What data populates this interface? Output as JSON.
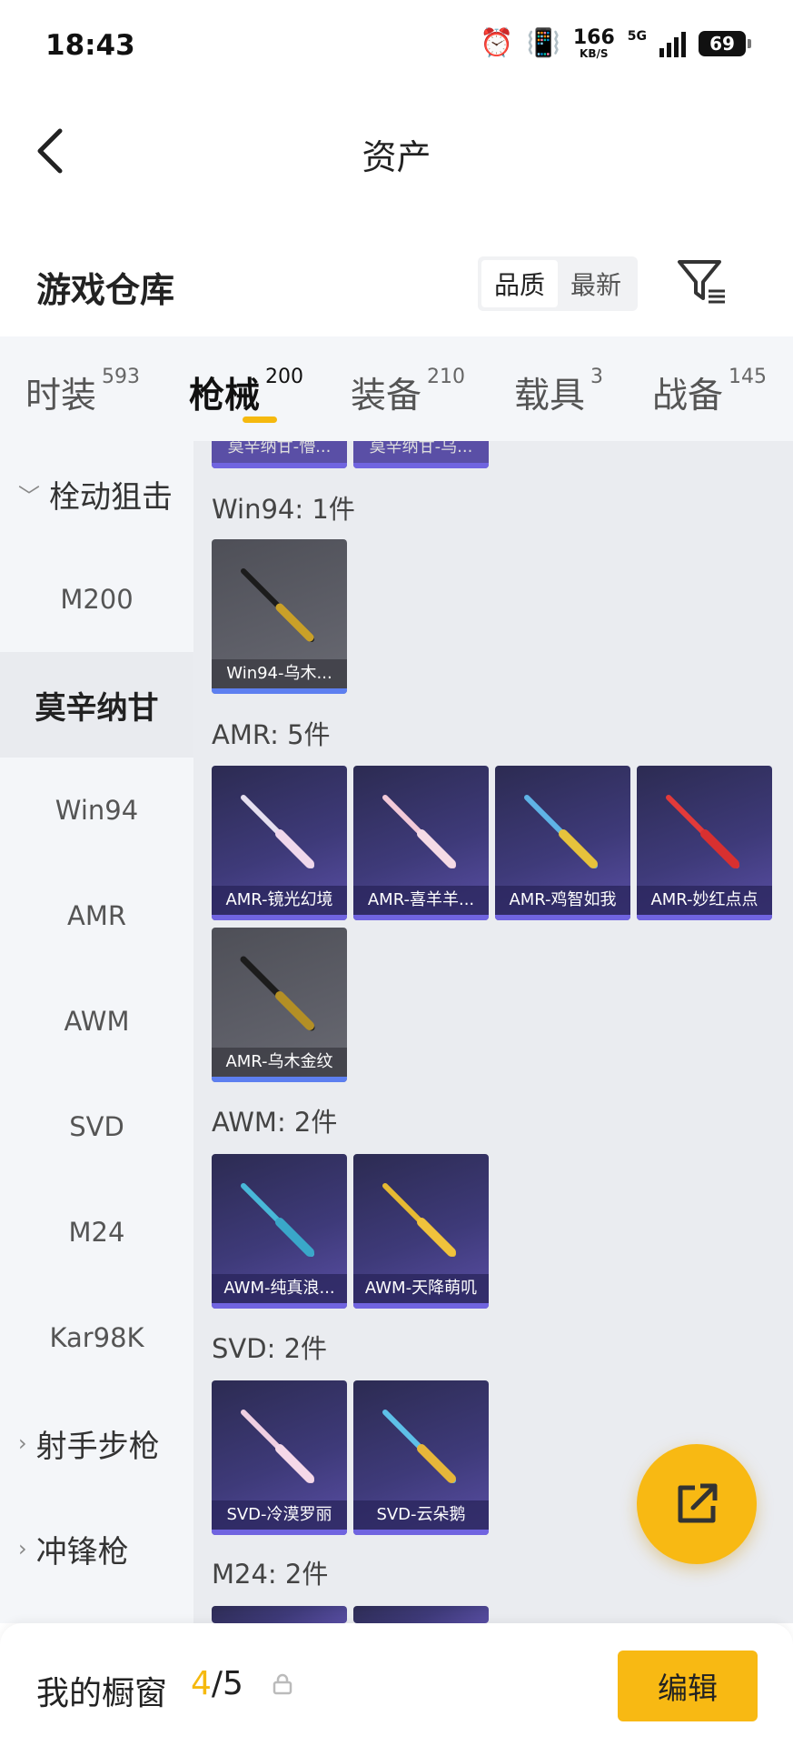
{
  "status": {
    "time": "18:43",
    "speed": "166",
    "speed_unit": "KB/S",
    "network": "5G",
    "battery": "69"
  },
  "header": {
    "title": "资产"
  },
  "warehouse": {
    "title": "游戏仓库",
    "sort": [
      "品质",
      "最新"
    ],
    "sort_selected": "品质"
  },
  "tabs": [
    {
      "label": "时装",
      "count": "593"
    },
    {
      "label": "枪械",
      "count": "200",
      "active": true
    },
    {
      "label": "装备",
      "count": "210"
    },
    {
      "label": "载具",
      "count": "3"
    },
    {
      "label": "战备",
      "count": "145"
    }
  ],
  "sidebar": {
    "group1": "栓动狙击",
    "items": [
      "M200",
      "莫辛纳甘",
      "Win94",
      "AMR",
      "AWM",
      "SVD",
      "M24",
      "Kar98K"
    ],
    "active": "莫辛纳甘",
    "group2": "射手步枪",
    "group3": "冲锋枪"
  },
  "content": {
    "top_cut": [
      "莫辛纳甘-懵...",
      "莫辛纳甘-乌..."
    ],
    "sections": [
      {
        "title": "Win94: 1件",
        "items": [
          {
            "name": "Win94-乌木...",
            "style": "gray"
          }
        ]
      },
      {
        "title": "AMR: 5件",
        "items": [
          {
            "name": "AMR-镜光幻境",
            "style": "purple"
          },
          {
            "name": "AMR-喜羊羊...",
            "style": "purple"
          },
          {
            "name": "AMR-鸡智如我",
            "style": "purple"
          },
          {
            "name": "AMR-妙红点点",
            "style": "purple"
          },
          {
            "name": "AMR-乌木金纹",
            "style": "gray"
          }
        ]
      },
      {
        "title": "AWM: 2件",
        "items": [
          {
            "name": "AWM-纯真浪...",
            "style": "purple"
          },
          {
            "name": "AWM-天降萌叽",
            "style": "purple"
          }
        ]
      },
      {
        "title": "SVD: 2件",
        "items": [
          {
            "name": "SVD-冷漠罗丽",
            "style": "purple"
          },
          {
            "name": "SVD-云朵鹅",
            "style": "purple"
          }
        ]
      },
      {
        "title": "M24: 2件",
        "items": []
      }
    ]
  },
  "bottom": {
    "label": "我的橱窗",
    "current": "4",
    "separator": "/",
    "total": "5",
    "edit_label": "编辑"
  },
  "colors": {
    "accent": "#f8b913",
    "card_purple": "#3e3a79",
    "card_gray": "#5e5f68"
  }
}
